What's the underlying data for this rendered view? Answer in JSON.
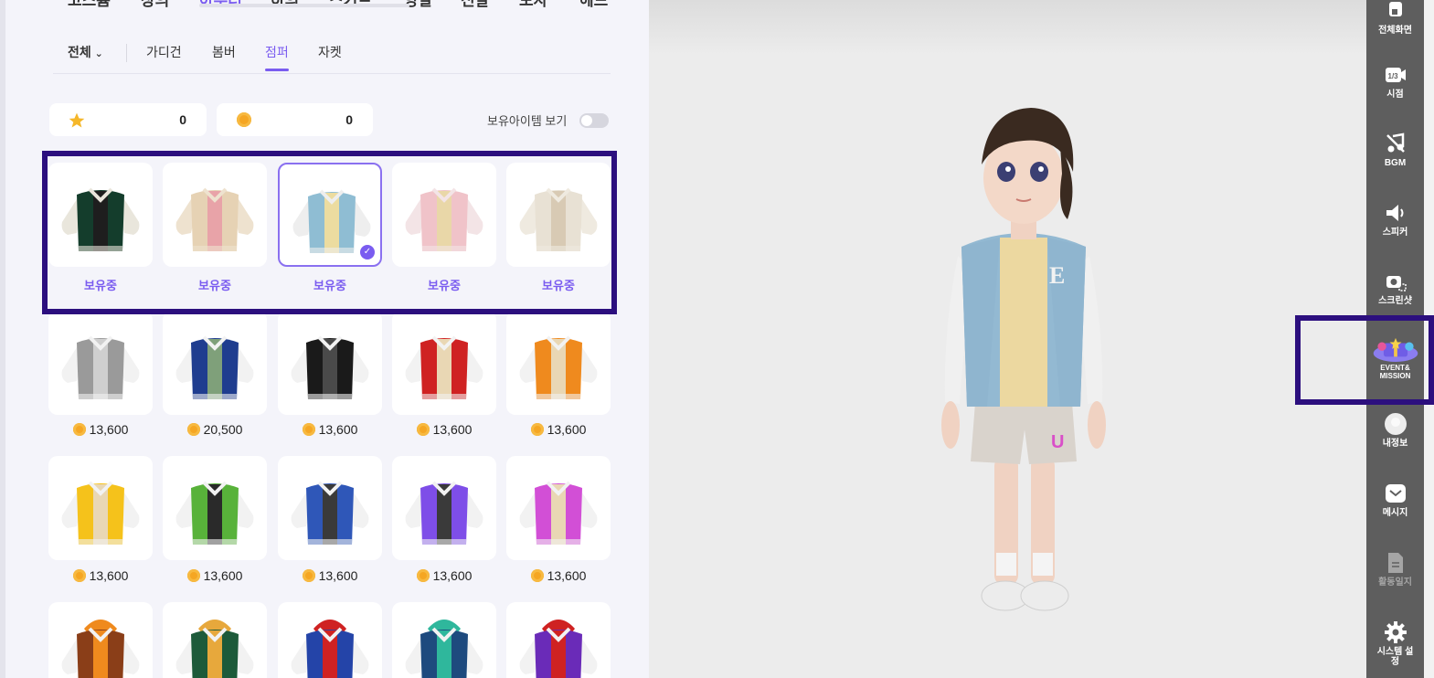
{
  "main_tabs": [
    {
      "label": "코스튬",
      "active": false
    },
    {
      "label": "상의",
      "active": false
    },
    {
      "label": "아우터",
      "active": true
    },
    {
      "label": "하의",
      "active": false
    },
    {
      "label": "스커트",
      "active": false
    },
    {
      "label": "양말",
      "active": false
    },
    {
      "label": "신발",
      "active": false
    },
    {
      "label": "모자",
      "active": false
    },
    {
      "label": "헤드",
      "active": false
    }
  ],
  "sub_tabs": {
    "all_label": "전체",
    "items": [
      {
        "label": "가디건",
        "active": false
      },
      {
        "label": "봄버",
        "active": false
      },
      {
        "label": "점퍼",
        "active": true
      },
      {
        "label": "자켓",
        "active": false
      }
    ]
  },
  "currency": {
    "star_count": "0",
    "coin_count": "0"
  },
  "toggle": {
    "label": "보유아이템 보기",
    "on": false
  },
  "owned_items": [
    {
      "status": "보유중",
      "body": "#143d2c",
      "sleeve": "#e9e6dc",
      "inner": "#1e1e1e",
      "selected": false
    },
    {
      "status": "보유중",
      "body": "#e6d2b4",
      "sleeve": "#eee2cf",
      "inner": "#e8a3a8",
      "selected": false
    },
    {
      "status": "보유중",
      "body": "#8fbdd3",
      "sleeve": "#eeeeee",
      "inner": "#ecdca0",
      "selected": true
    },
    {
      "status": "보유중",
      "body": "#f0c3c9",
      "sleeve": "#f3e4e6",
      "inner": "#e9d7a8",
      "selected": false
    },
    {
      "status": "보유중",
      "body": "#e8e1d4",
      "sleeve": "#efeae0",
      "inner": "#d8cab4",
      "selected": false
    }
  ],
  "shop_row1": [
    {
      "price": "13,600",
      "body": "#9a9a9a",
      "sleeve": "#f2f2f2",
      "inner": "#cfcfcf"
    },
    {
      "price": "20,500",
      "body": "#1f3d8f",
      "sleeve": "#f2f2f2",
      "inner": "#7fa07a"
    },
    {
      "price": "13,600",
      "body": "#1a1a1a",
      "sleeve": "#f2f2f2",
      "inner": "#4a4a4a"
    },
    {
      "price": "13,600",
      "body": "#cf2222",
      "sleeve": "#f2f2f2",
      "inner": "#e9d7b4"
    },
    {
      "price": "13,600",
      "body": "#ef8a1e",
      "sleeve": "#f2f2f2",
      "inner": "#e9d7b4"
    }
  ],
  "shop_row2": [
    {
      "price": "13,600",
      "body": "#f5c21b",
      "sleeve": "#f2f2f2",
      "inner": "#e9d7b4"
    },
    {
      "price": "13,600",
      "body": "#58b23a",
      "sleeve": "#f2f2f2",
      "inner": "#2a2a2a"
    },
    {
      "price": "13,600",
      "body": "#2f57b8",
      "sleeve": "#f2f2f2",
      "inner": "#3a3a3a"
    },
    {
      "price": "13,600",
      "body": "#7e4ee8",
      "sleeve": "#f2f2f2",
      "inner": "#3a3a3a"
    },
    {
      "price": "13,600",
      "body": "#d24fd6",
      "sleeve": "#f2f2f2",
      "inner": "#e9d7b4"
    }
  ],
  "shop_row3": [
    {
      "body": "#8a3e18",
      "sleeve": "#f2f2f2",
      "inner": "#ef8a1e"
    },
    {
      "body": "#1d5a3a",
      "sleeve": "#f2f2f2",
      "inner": "#e7a83c"
    },
    {
      "body": "#2444a8",
      "sleeve": "#f2f2f2",
      "inner": "#cf2222"
    },
    {
      "body": "#1e4a7e",
      "sleeve": "#f2f2f2",
      "inner": "#2fb79c"
    },
    {
      "body": "#6a2bb8",
      "sleeve": "#f2f2f2",
      "inner": "#cf2222"
    }
  ],
  "right_bar": [
    {
      "label": "전체화면",
      "icon": "fullscreen-icon",
      "disabled": false
    },
    {
      "label": "시점",
      "icon": "camera-view-icon",
      "icon_text": "1/3",
      "disabled": false
    },
    {
      "label": "BGM",
      "icon": "music-off-icon",
      "disabled": false
    },
    {
      "label": "스피커",
      "icon": "speaker-icon",
      "disabled": false
    },
    {
      "label": "스크린샷",
      "icon": "screenshot-icon",
      "disabled": false
    },
    {
      "label": "EVENT& MISSION",
      "icon": "event-gift-icon",
      "disabled": false
    },
    {
      "label": "내정보",
      "icon": "profile-icon",
      "disabled": false
    },
    {
      "label": "메시지",
      "icon": "message-icon",
      "disabled": false
    },
    {
      "label": "활동일지",
      "icon": "activity-log-icon",
      "disabled": true
    },
    {
      "label": "시스템 설정",
      "icon": "settings-gear-icon",
      "disabled": false
    }
  ],
  "colors": {
    "accent": "#7a5cf0",
    "highlight": "#2c0f7e",
    "panel_bg": "#f4f4fa",
    "toolbar_bg": "#5e5e5e",
    "coin": "#f5a623"
  }
}
